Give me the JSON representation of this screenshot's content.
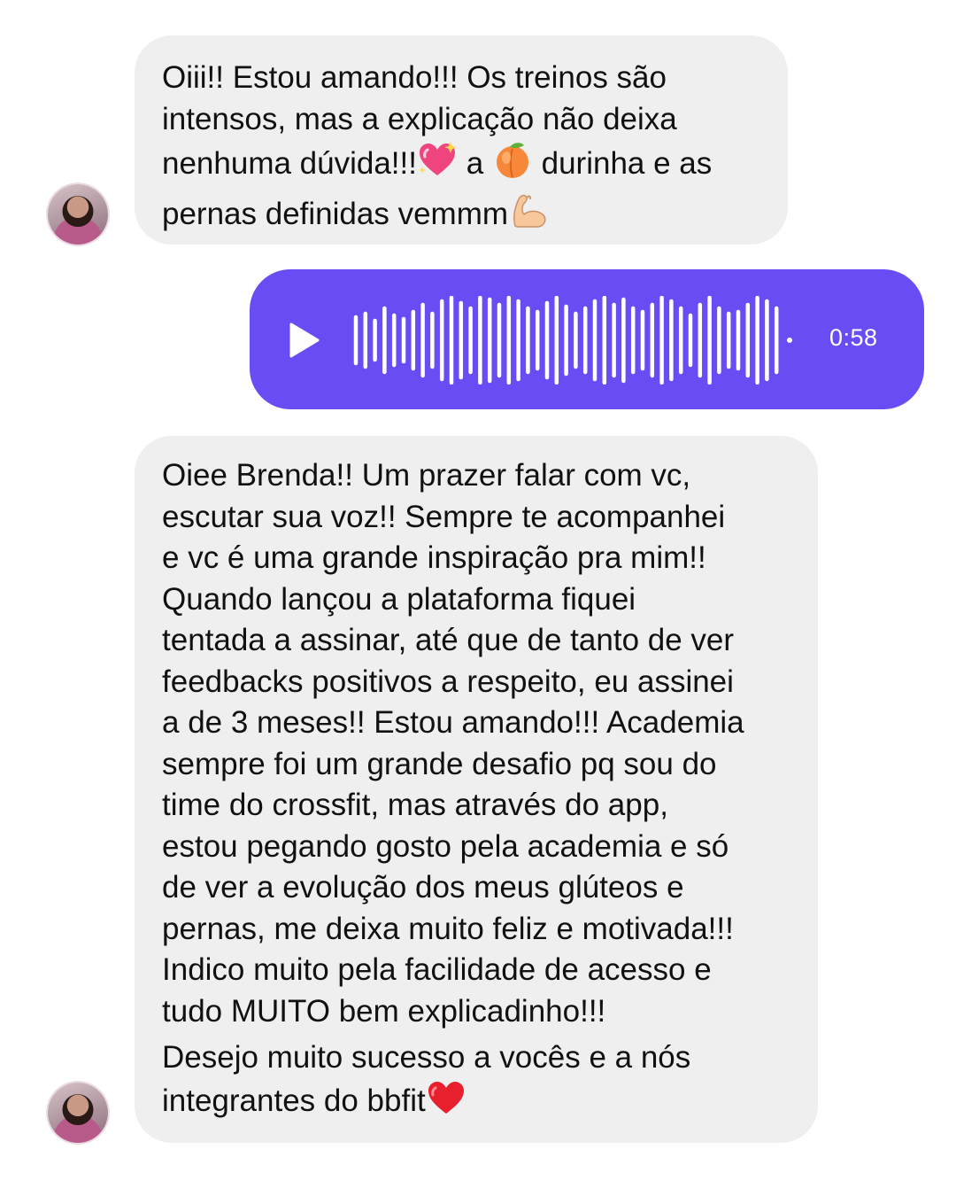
{
  "messages": [
    {
      "type": "incoming-text",
      "lines": [
        "Oiii!! Estou amando!!! Os treinos são",
        "intensos, mas a explicação não deixa",
        [
          "nenhuma dúvida!!!",
          "sparkling-heart-emoji",
          " a ",
          "peach-emoji",
          " durinha e as"
        ],
        [
          "pernas definidas vemmm",
          "flexed-biceps-emoji"
        ]
      ]
    },
    {
      "type": "outgoing-voice",
      "play_icon": "play-icon",
      "duration": "0:58",
      "color": "#6a4cf5"
    },
    {
      "type": "incoming-text",
      "lines": [
        "Oiee Brenda!! Um prazer falar com vc,",
        "escutar sua voz!! Sempre te acompanhei",
        "e vc é uma grande inspiração pra mim!!",
        "Quando lançou a plataforma fiquei",
        "tentada a assinar, até que de tanto de ver",
        "feedbacks positivos a respeito, eu assinei",
        "a de 3 meses!! Estou amando!!! Academia",
        "sempre foi um grande desafio pq sou do",
        "time do crossfit, mas através do app,",
        "estou pegando gosto pela academia e só",
        "de ver a evolução dos meus glúteos e",
        "pernas, me deixa muito feliz e motivada!!!",
        "Indico muito pela facilidade de acesso e",
        "tudo MUITO bem explicadinho!!!",
        "Desejo muito sucesso a vocês e a nós",
        [
          "integrantes do bbfit",
          "red-heart-emoji"
        ]
      ]
    }
  ],
  "colors": {
    "incoming_bubble": "#efefef",
    "outgoing_bubble": "#6a4cf5",
    "text": "#111111"
  }
}
